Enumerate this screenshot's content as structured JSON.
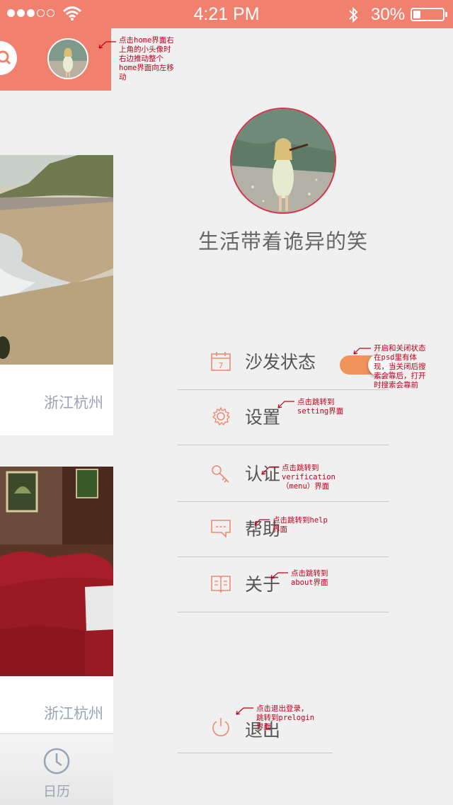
{
  "status_bar": {
    "time": "4:21 PM",
    "battery": "30%",
    "signal_dots": [
      true,
      true,
      true,
      false,
      false
    ]
  },
  "home": {
    "cards": [
      {
        "city": "浙江杭州",
        "photo": "beach-photo"
      },
      {
        "city": "浙江杭州",
        "photo": "hotel-room-photo"
      }
    ],
    "tab_label": "日历"
  },
  "menu": {
    "username": "生活带着诡异的笑",
    "items": [
      {
        "label": "沙发状态",
        "icon": "calendar-icon",
        "calendar_day": "7"
      },
      {
        "label": "设置",
        "icon": "gear-icon"
      },
      {
        "label": "认证",
        "icon": "key-icon"
      },
      {
        "label": "帮助",
        "icon": "chat-icon"
      },
      {
        "label": "关于",
        "icon": "book-icon"
      }
    ],
    "sofa_toggle_on": true,
    "logout_label": "退出"
  },
  "annotations": {
    "avatar_note": "点击home界面右\n上角的小头像时\n右边推动整个\nhome界面向左移\n动",
    "toggle_note": "开启和关闭状态\n在psd里有体\n现，当关闭后搜\n索会靠后，打开\n时搜索会靠前",
    "settings_note": "点击跳转到\nsetting界面",
    "verify_note": "点击跳转到\nverification\n（menu）界面",
    "help_note": "点击跳转到help\n界面",
    "about_note": "点击跳转到\nabout界面",
    "logout_note": "点击退出登录，\n跳转到prelogin\n界面"
  },
  "colors": {
    "brand": "#f1806e",
    "toggle": "#f0935a",
    "icon": "#ee8a74",
    "annotation": "#c0001a"
  }
}
